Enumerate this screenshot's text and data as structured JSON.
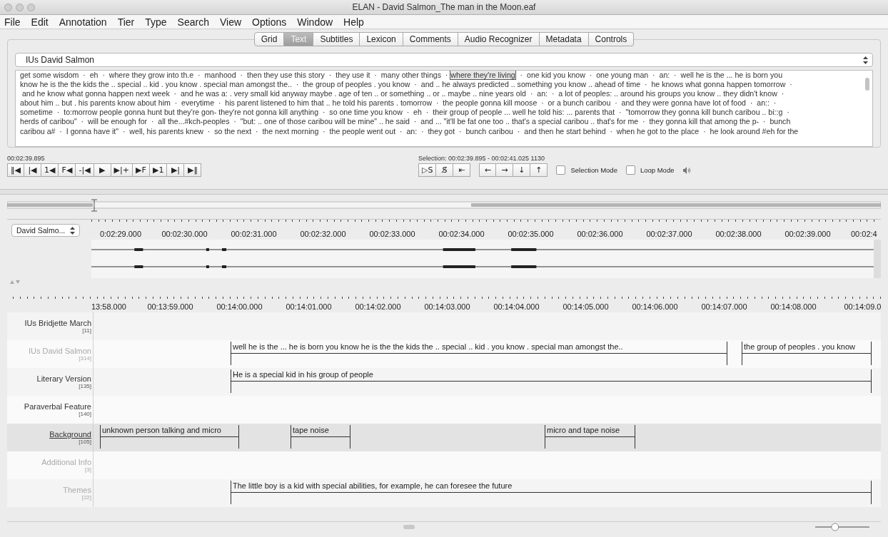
{
  "window": {
    "title": "ELAN - David Salmon_The man in the Moon.eaf"
  },
  "menu": [
    "File",
    "Edit",
    "Annotation",
    "Tier",
    "Type",
    "Search",
    "View",
    "Options",
    "Window",
    "Help"
  ],
  "tabs": [
    {
      "label": "Grid",
      "selected": false
    },
    {
      "label": "Text",
      "selected": true
    },
    {
      "label": "Subtitles",
      "selected": false
    },
    {
      "label": "Lexicon",
      "selected": false
    },
    {
      "label": "Comments",
      "selected": false
    },
    {
      "label": "Audio Recognizer",
      "selected": false
    },
    {
      "label": "Metadata",
      "selected": false
    },
    {
      "label": "Controls",
      "selected": false
    }
  ],
  "text_view": {
    "tier": "IUs David Salmon",
    "lines": [
      [
        {
          "text": "get some wisdom  ·  eh  ·  where they grow into th.e  ·  manhood  ·  then they use this story  ·  they use it  ·  many other things  · ",
          "selected": false
        },
        {
          "text": "where they're living",
          "selected": true
        },
        {
          "text": "  ·  one kid you know  ·  one young man  ·  an:  ·  well he is the ... he is born you",
          "selected": false
        }
      ],
      [
        {
          "text": "know he is the the kids the .. special .. kid . you know . special man amongst the..  ·  the group of peoples . you know  ·  and .. he always predicted .. something you know .. ahead of time  ·  he knows what gonna happen tomorrow  ·",
          "selected": false
        }
      ],
      [
        {
          "text": " and he know what gonna happen next week  ·  and he was a: . very small kid anyway maybe . age of ten .. or something .. or .. maybe .. nine years old  ·  an:  ·  a lot of peoples: .. around his groups you know .. they didn't know  ·",
          "selected": false
        }
      ],
      [
        {
          "text": "about him .. but . his parents know about him  ·  everytime  ·  his parent listened to him that .. he told his parents . tomorrow  ·  the people gonna kill moose  ·  or a bunch caribou  ·  and they were gonna have lot of food  ·  an::  ·",
          "selected": false
        }
      ],
      [
        {
          "text": "sometime  ·  to:morrow people gonna hunt but they're gon- they're not gonna kill anything  ·  so one time you know  ·  eh  ·  their group of people ... well he told his: ... parents that  ·  \"tomorrow they gonna kill bunch caribou .. bi::g  ·",
          "selected": false
        }
      ],
      [
        {
          "text": "herds of caribou\"  ·  will be enough for  ·  all the...#kch-peoples  ·  \"but: .. one of those caribou will be mine\" .. he said  ·  and ... \"it'll be fat one too .. that's a special caribou .. that's for me  ·  they gonna kill that among the p-  ·  bunch",
          "selected": false
        }
      ],
      [
        {
          "text": "caribou a#  ·  I gonna have it\"  ·  well, his parents knew  ·  so the next  ·  the next morning  ·  the people went out  ·  an:  ·  they got  ·  bunch caribou  ·  and then he start behind  ·  when he got to the place  ·  he look around #eh for the",
          "selected": false
        }
      ]
    ]
  },
  "media_controls": {
    "time": "00:02:39.895",
    "selection": "Selection: 00:02:39.895 - 00:02:41.025  1130",
    "play_buttons": [
      "‖◀",
      "|◀",
      "1◀",
      "F◀",
      "-|◀",
      "▶",
      "▶|+",
      "▶F",
      "▶1",
      "▶|",
      "▶‖"
    ],
    "selection_buttons": [
      "▷S",
      "S̸",
      "⇤"
    ],
    "nav_buttons": [
      "←",
      "→",
      "↓",
      "↑"
    ],
    "modes": [
      {
        "label": "Selection Mode",
        "checked": false
      },
      {
        "label": "Loop Mode",
        "checked": false
      }
    ]
  },
  "waveform": {
    "track": "David Salmo...",
    "ticks": [
      "0:02:29.000",
      "00:02:30.000",
      "00:02:31.000",
      "00:02:32.000",
      "00:02:33.000",
      "00:02:34.000",
      "00:02:35.000",
      "00:02:36.000",
      "00:02:37.000",
      "00:02:38.000",
      "00:02:39.000",
      "00:02:4"
    ]
  },
  "zoom_slider": {
    "level": 0.35
  },
  "timeline": {
    "ticks": [
      "13:58.000",
      "00:13:59.000",
      "00:14:00.000",
      "00:14:01.000",
      "00:14:02.000",
      "00:14:03.000",
      "00:14:04.000",
      "00:14:05.000",
      "00:14:06.000",
      "00:14:07.000",
      "00:14:08.000",
      "00:14:09.0"
    ],
    "tiers": [
      {
        "name": "IUs Bridjette March",
        "count": "[11]",
        "active": false,
        "dimmed": false
      },
      {
        "name": "IUs David Salmon",
        "count": "[314]",
        "active": false,
        "dimmed": true,
        "annotations": [
          {
            "text": "well he is the ... he is born you know he is the the kids the .. special .. kid . you know . special man amongst the.."
          },
          {
            "text": "the group of peoples . you know"
          }
        ]
      },
      {
        "name": "Literary Version",
        "count": "[135]",
        "active": false,
        "dimmed": false,
        "annotations": [
          {
            "text": "He is a special kid in his group of people"
          }
        ]
      },
      {
        "name": "Paraverbal Feature",
        "count": "[140]",
        "active": false,
        "dimmed": false
      },
      {
        "name": "Background",
        "count": "[105]",
        "active": true,
        "dimmed": false,
        "annotations": [
          {
            "text": "unknown person talking and micro"
          },
          {
            "text": "tape noise"
          },
          {
            "text": "micro and tape noise"
          }
        ]
      },
      {
        "name": "Additional Info",
        "count": "[3]",
        "active": false,
        "dimmed": true
      },
      {
        "name": "Themes",
        "count": "[22]",
        "active": false,
        "dimmed": true,
        "annotations": [
          {
            "text": "The little boy is a kid with special abilities, for example, he can foresee the future"
          }
        ]
      }
    ]
  }
}
